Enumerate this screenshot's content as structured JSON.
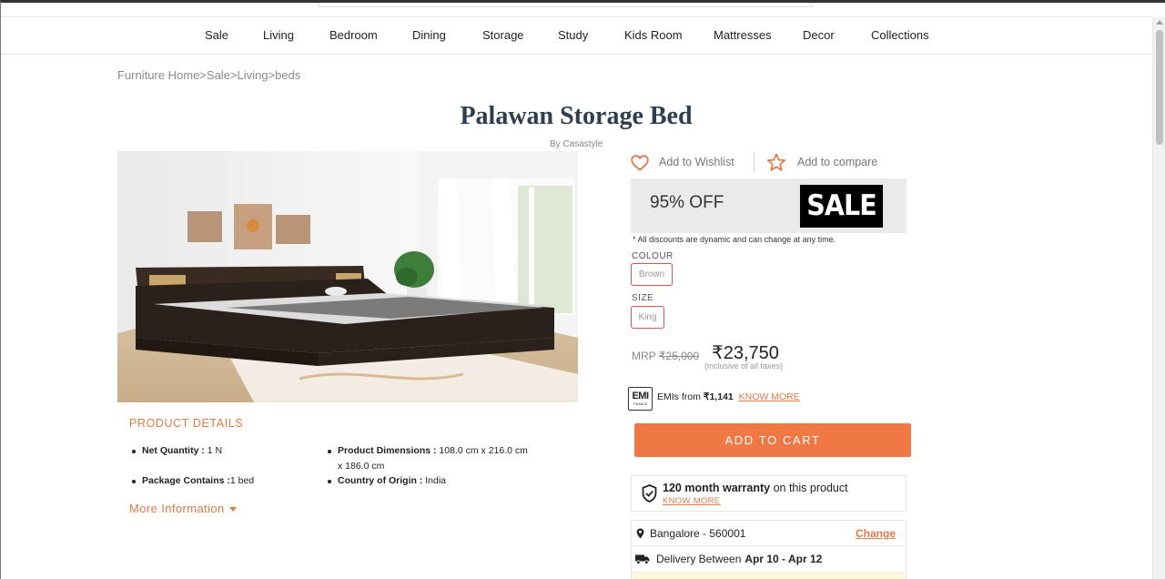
{
  "nav": {
    "items": [
      "Sale",
      "Living",
      "Bedroom",
      "Dining",
      "Storage",
      "Study",
      "Kids Room",
      "Mattresses",
      "Decor",
      "Collections"
    ]
  },
  "breadcrumb": "Furniture Home>Sale>Living>beds",
  "product": {
    "title": "Palawan Storage Bed",
    "brand": "By Casastyle",
    "image_icon": "bed-photo"
  },
  "actions": {
    "wishlist_label": "Add to Wishlist",
    "compare_label": "Add to compare"
  },
  "offer": {
    "discount": "95% OFF",
    "sale_badge": "SALE",
    "disclaimer": "* All discounts are dynamic and can change at any time."
  },
  "options": {
    "colour_label": "COLOUR",
    "colour_value": "Brown",
    "size_label": "SIZE",
    "size_value": "King"
  },
  "pricing": {
    "mrp_label": "MRP",
    "mrp_value": "₹25,000",
    "price": "₹23,750",
    "tax_note": "(inclusive of all taxes)"
  },
  "emi": {
    "badge_top": "EMI",
    "badge_bottom": "FINANCE",
    "text_prefix": "EMIs from",
    "amount": "₹1,141",
    "link": "KNOW MORE"
  },
  "cart": {
    "label": "ADD TO CART"
  },
  "warranty": {
    "bold": "120 month warranty",
    "rest": "on this product",
    "link": "KNOW MORE"
  },
  "delivery": {
    "location": "Bangalore - 560001",
    "change_label": "Change",
    "text": "Delivery Between",
    "dates": "Apr 10 - Apr 12"
  },
  "details": {
    "heading": "PRODUCT DETAILS",
    "net_quantity_label": "Net Quantity :",
    "net_quantity_value": " 1 N",
    "dimensions_label": "Product Dimensions :",
    "dimensions_value": " 108.0 cm x 216.0 cm x 186.0 cm",
    "package_label": "Package Contains :",
    "package_value": "1 bed",
    "origin_label": "Country of Origin :",
    "origin_value": " India",
    "more_info": "More Information"
  },
  "colors": {
    "accent": "#f07845",
    "link": "#e07a45",
    "title": "#2f3e4f",
    "chip_border": "#d9534f"
  }
}
